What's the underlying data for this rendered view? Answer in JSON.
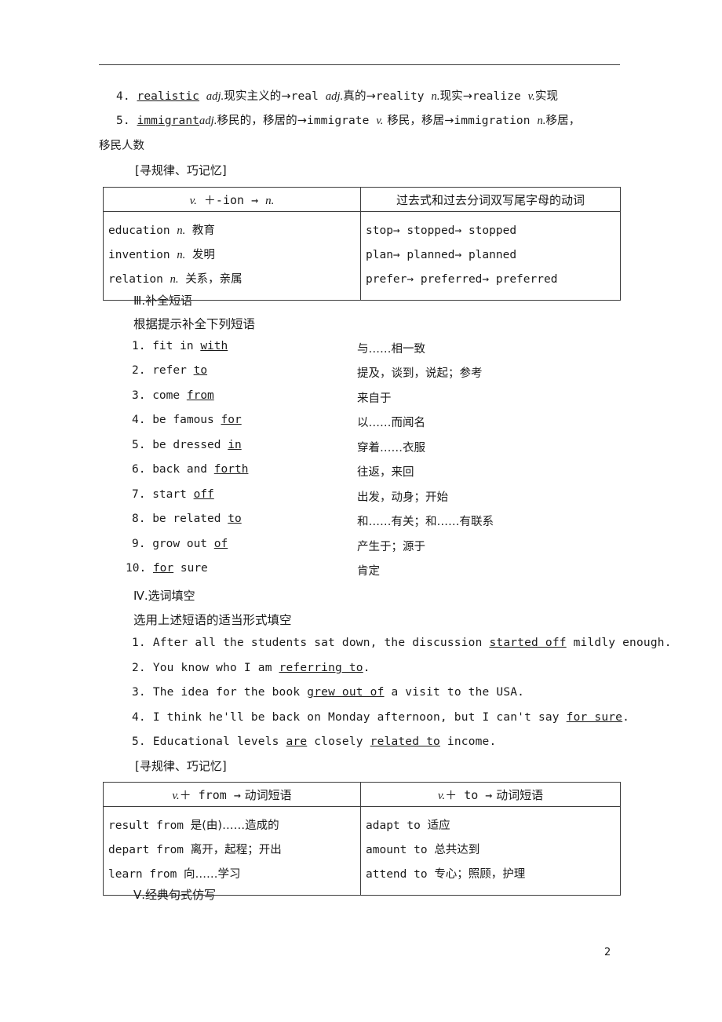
{
  "page": {
    "number": "2",
    "header_rule": true
  },
  "word_formation": {
    "items": [
      {
        "num": "4.",
        "root": "realistic",
        "root_pos": "adj.",
        "root_zh": "现实主义的",
        "chain": [
          {
            "word": "real",
            "pos": "adj.",
            "zh": "真的"
          },
          {
            "word": "reality",
            "pos": "n.",
            "zh": "现实"
          },
          {
            "word": "realize",
            "pos": "v.",
            "zh": "实现"
          }
        ]
      },
      {
        "num": "5.",
        "root": "immigrant",
        "root_pos": "adj.",
        "root_zh": "移民的，移居的",
        "chain": [
          {
            "word": "immigrate",
            "pos": "v.",
            "zh": "移民，移居"
          },
          {
            "word": "immigration",
            "pos": "n.",
            "zh": "移居，"
          }
        ],
        "wrap": "移民人数"
      }
    ],
    "arrow": "→"
  },
  "tip_label_1": "[寻规律、巧记忆]",
  "table1": {
    "headers": {
      "left_pos": "v.",
      "left_rule": "＋-ion",
      "left_arrow": "→",
      "left_result": "n.",
      "right": "过去式和过去分词双写尾字母的动词"
    },
    "left_rows": [
      {
        "word": "education",
        "pos": "n.",
        "zh": "教育"
      },
      {
        "word": "invention",
        "pos": "n.",
        "zh": "发明"
      },
      {
        "word": "relation",
        "pos": "n.",
        "zh": "关系，亲属"
      }
    ],
    "right_rows": [
      "stop→ stopped→ stopped",
      "plan→ planned→ planned",
      "prefer→ preferred→ preferred"
    ]
  },
  "section3": {
    "number": "Ⅲ.",
    "title": "补全短语",
    "instruction": "根据提示补全下列短语",
    "phrases": [
      {
        "num": "1.",
        "pre": "fit in ",
        "blank": "with",
        "post": "",
        "zh": "与……相一致"
      },
      {
        "num": "2.",
        "pre": "refer ",
        "blank": "to",
        "post": "",
        "zh": "提及，谈到，说起；参考"
      },
      {
        "num": "3.",
        "pre": "come ",
        "blank": "from",
        "post": "",
        "zh": "来自于"
      },
      {
        "num": "4.",
        "pre": "be famous ",
        "blank": "for",
        "post": "",
        "zh": "以……而闻名"
      },
      {
        "num": "5.",
        "pre": "be dressed ",
        "blank": "in",
        "post": "",
        "zh": "穿着……衣服"
      },
      {
        "num": "6.",
        "pre": "back and ",
        "blank": "forth",
        "post": "",
        "zh": "往返，来回"
      },
      {
        "num": "7.",
        "pre": "start ",
        "blank": "off",
        "post": "",
        "zh": "出发，动身；开始"
      },
      {
        "num": "8.",
        "pre": "be related ",
        "blank": "to",
        "post": "",
        "zh": "和……有关；和……有联系"
      },
      {
        "num": "9.",
        "pre": "grow out ",
        "blank": "of",
        "post": "",
        "zh": "产生于；源于"
      },
      {
        "num": "10.",
        "pre": "",
        "blank": "for",
        "post": " sure",
        "zh": "肯定"
      }
    ]
  },
  "section4": {
    "number": "Ⅳ.",
    "title": "选词填空",
    "instruction": "选用上述短语的适当形式填空",
    "sentences": [
      {
        "num": "1.",
        "pre": "After all the students sat down, the discussion ",
        "blank": "started off",
        "post": " mildly enough."
      },
      {
        "num": "2.",
        "pre": "You know who I am ",
        "blank": "referring to",
        "post": "."
      },
      {
        "num": "3.",
        "pre": "The idea for the book ",
        "blank": "grew out of",
        "post": " a visit to the USA."
      },
      {
        "num": "4.",
        "pre": "I think he'll be back on Monday afternoon, but I can't say ",
        "blank": "for sure",
        "post": "."
      },
      {
        "num": "5.",
        "pre": "Educational levels ",
        "blank": "are",
        "post": " closely ",
        "blank2": "related to",
        "post2": " income."
      }
    ]
  },
  "tip_label_2": "[寻规律、巧记忆]",
  "table2": {
    "headers": {
      "left_pos": "v.",
      "left_prep": "＋ from",
      "left_arrow": "→",
      "left_result": "动词短语",
      "right_pos": "v.",
      "right_prep": "＋ to",
      "right_arrow": "→",
      "right_result": "动词短语"
    },
    "left_rows": [
      {
        "en": "result from ",
        "zh": "是(由)……造成的"
      },
      {
        "en": "depart from ",
        "zh": "离开，起程；开出"
      },
      {
        "en": "learn from ",
        "zh": "向……学习"
      }
    ],
    "right_rows": [
      {
        "en": "adapt to ",
        "zh": "适应"
      },
      {
        "en": "amount to ",
        "zh": "总共达到"
      },
      {
        "en": "attend to ",
        "zh": "专心；照顾，护理"
      }
    ]
  },
  "section5": {
    "number": "Ⅴ.",
    "title": "经典句式仿写"
  }
}
